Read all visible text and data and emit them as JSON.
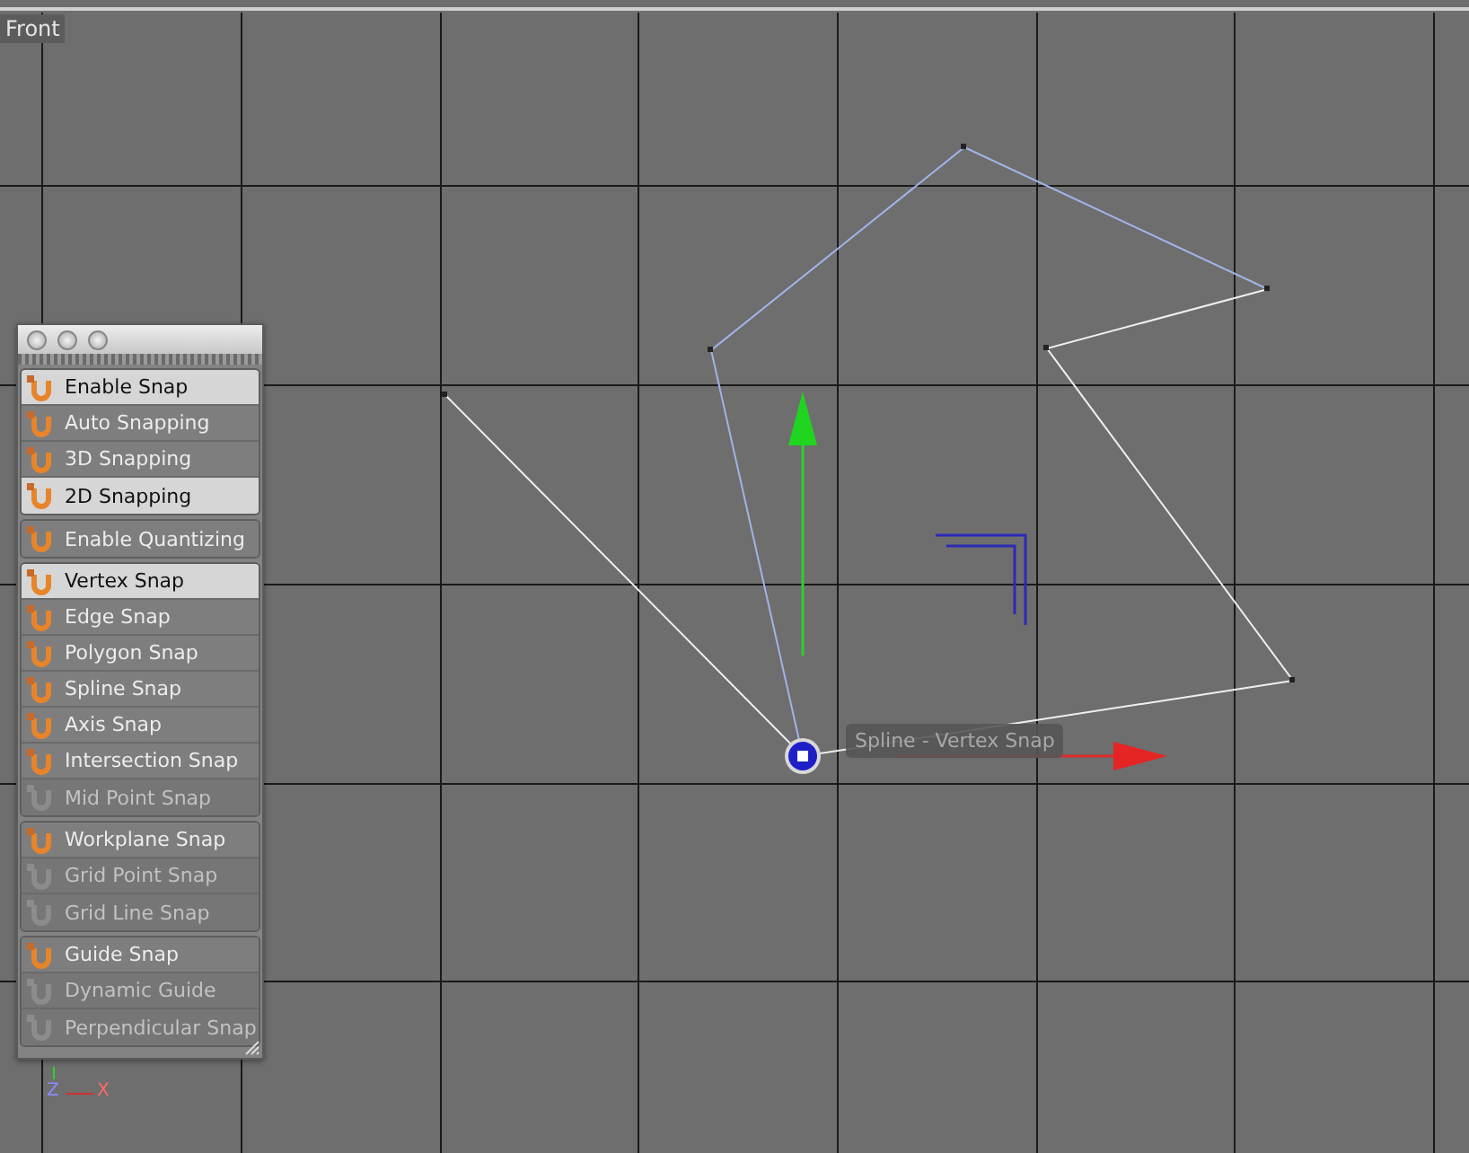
{
  "viewport": {
    "label": "Front",
    "tooltip": "Spline - Vertex Snap",
    "axis_gizmo": {
      "vertical_label": "Z",
      "horizontal_label": "X"
    }
  },
  "snap_palette": {
    "groups": [
      {
        "items": [
          {
            "label": "Enable Snap",
            "checked": true,
            "disabled": false
          },
          {
            "label": "Auto Snapping",
            "checked": false,
            "disabled": false
          },
          {
            "label": "3D Snapping",
            "checked": false,
            "disabled": false
          },
          {
            "label": "2D Snapping",
            "checked": true,
            "disabled": false
          }
        ]
      },
      {
        "items": [
          {
            "label": "Enable Quantizing",
            "checked": false,
            "disabled": false
          }
        ]
      },
      {
        "items": [
          {
            "label": "Vertex Snap",
            "checked": true,
            "disabled": false
          },
          {
            "label": "Edge Snap",
            "checked": false,
            "disabled": false
          },
          {
            "label": "Polygon Snap",
            "checked": false,
            "disabled": false
          },
          {
            "label": "Spline Snap",
            "checked": false,
            "disabled": false
          },
          {
            "label": "Axis Snap",
            "checked": false,
            "disabled": false
          },
          {
            "label": "Intersection Snap",
            "checked": false,
            "disabled": false
          },
          {
            "label": "Mid Point Snap",
            "checked": false,
            "disabled": true
          }
        ]
      },
      {
        "items": [
          {
            "label": "Workplane Snap",
            "checked": false,
            "disabled": false
          },
          {
            "label": "Grid Point Snap",
            "checked": false,
            "disabled": true
          },
          {
            "label": "Grid Line Snap",
            "checked": false,
            "disabled": true
          }
        ]
      },
      {
        "items": [
          {
            "label": "Guide Snap",
            "checked": false,
            "disabled": false
          },
          {
            "label": "Dynamic Guide",
            "checked": false,
            "disabled": true
          },
          {
            "label": "Perpendicular Snap",
            "checked": false,
            "disabled": true
          }
        ]
      }
    ]
  }
}
